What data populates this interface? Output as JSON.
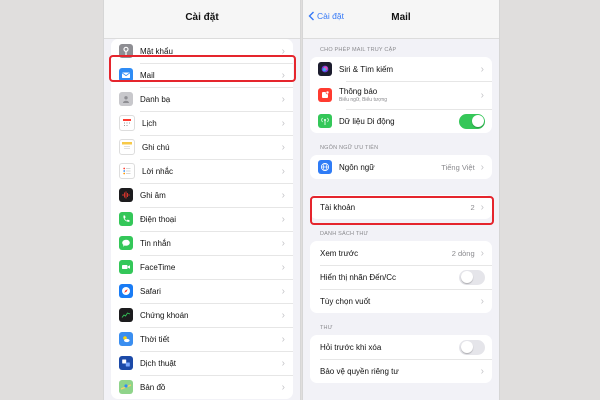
{
  "left": {
    "title": "Cài đặt",
    "items": [
      {
        "label": "Mật khẩu",
        "icon": "key-icon",
        "color": "#8e8e93"
      },
      {
        "label": "Mail",
        "icon": "mail-icon",
        "color": "#2f8cf5"
      },
      {
        "label": "Danh bạ",
        "icon": "contacts-icon",
        "color": "#c8c8cc"
      },
      {
        "label": "Lịch",
        "icon": "calendar-icon",
        "color": "#ffffff"
      },
      {
        "label": "Ghi chú",
        "icon": "notes-icon",
        "color": "#ffffff"
      },
      {
        "label": "Lời nhắc",
        "icon": "reminders-icon",
        "color": "#ffffff"
      },
      {
        "label": "Ghi âm",
        "icon": "voice-memo-icon",
        "color": "#1c1c1e"
      },
      {
        "label": "Điện thoại",
        "icon": "phone-icon",
        "color": "#34c759"
      },
      {
        "label": "Tin nhắn",
        "icon": "messages-icon",
        "color": "#34c759"
      },
      {
        "label": "FaceTime",
        "icon": "facetime-icon",
        "color": "#34c759"
      },
      {
        "label": "Safari",
        "icon": "safari-icon",
        "color": "#1a7cf5"
      },
      {
        "label": "Chứng khoán",
        "icon": "stocks-icon",
        "color": "#1c1c1e"
      },
      {
        "label": "Thời tiết",
        "icon": "weather-icon",
        "color": "#3a8ef0"
      },
      {
        "label": "Dịch thuật",
        "icon": "translate-icon",
        "color": "#1c4aa8"
      },
      {
        "label": "Bản đồ",
        "icon": "maps-icon",
        "color": "#8fd48a"
      }
    ]
  },
  "right": {
    "back_label": "Cài đặt",
    "title": "Mail",
    "section_access": "CHO PHÉP MAIL TRUY CẬP",
    "access_items": [
      {
        "label": "Siri & Tìm kiếm",
        "icon": "siri-icon",
        "color": "#1c1c2e"
      },
      {
        "label": "Thông báo",
        "sub": "Biểu ngữ, Biểu tượng",
        "icon": "notifications-icon",
        "color": "#ff3b30"
      },
      {
        "label": "Dữ liệu Di động",
        "icon": "cellular-icon",
        "color": "#34c759",
        "toggle": "on"
      }
    ],
    "section_lang": "NGÔN NGỮ ƯU TIÊN",
    "lang_item": {
      "label": "Ngôn ngữ",
      "value": "Tiếng Việt",
      "icon": "globe-icon",
      "color": "#2f7cf6"
    },
    "accounts": {
      "label": "Tài khoản",
      "value": "2"
    },
    "section_list": "DANH SÁCH THƯ",
    "list_items": [
      {
        "label": "Xem trước",
        "value": "2 dòng"
      },
      {
        "label": "Hiển thị nhãn Đến/Cc",
        "toggle": "off"
      },
      {
        "label": "Tùy chọn vuốt"
      }
    ],
    "section_mail": "THƯ",
    "mail_items": [
      {
        "label": "Hỏi trước khi xóa",
        "toggle": "off"
      },
      {
        "label": "Bảo vệ quyền riêng tư"
      }
    ]
  },
  "highlight_color": "#e5252d",
  "toggle_on_color": "#35c759"
}
